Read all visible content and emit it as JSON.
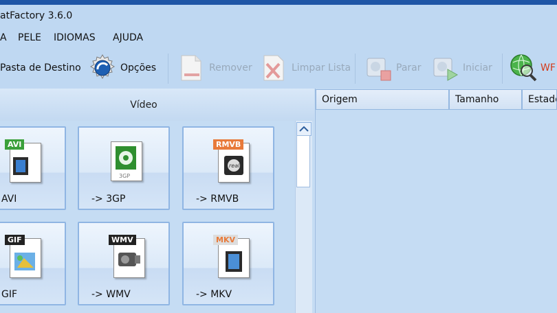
{
  "window": {
    "title": "atFactory 3.6.0"
  },
  "menu": {
    "items": [
      "A",
      "PELE",
      "IDIOMAS",
      "AJUDA"
    ]
  },
  "toolbar": {
    "pasta_destino": "Pasta de Destino",
    "opcoes": "Opções",
    "remover": "Remover",
    "limpar_lista": "Limpar Lista",
    "parar": "Parar",
    "iniciar": "Iniciar",
    "www": "WF"
  },
  "left_panel": {
    "title": "Vídeo",
    "tiles": [
      {
        "label": "AVI",
        "badge": "AVI"
      },
      {
        "label": "-> 3GP",
        "badge": "3GP"
      },
      {
        "label": "-> RMVB",
        "badge": "RMVB"
      },
      {
        "label": "GIF",
        "badge": "GIF"
      },
      {
        "label": "-> WMV",
        "badge": "WMV"
      },
      {
        "label": "-> MKV",
        "badge": "MKV"
      }
    ]
  },
  "task_list": {
    "columns": [
      "Origem",
      "Tamanho",
      "Estado"
    ]
  },
  "colors": {
    "background": "#c7def5",
    "title_strip": "#1f56a6",
    "tile_border": "#8fb5e3"
  }
}
